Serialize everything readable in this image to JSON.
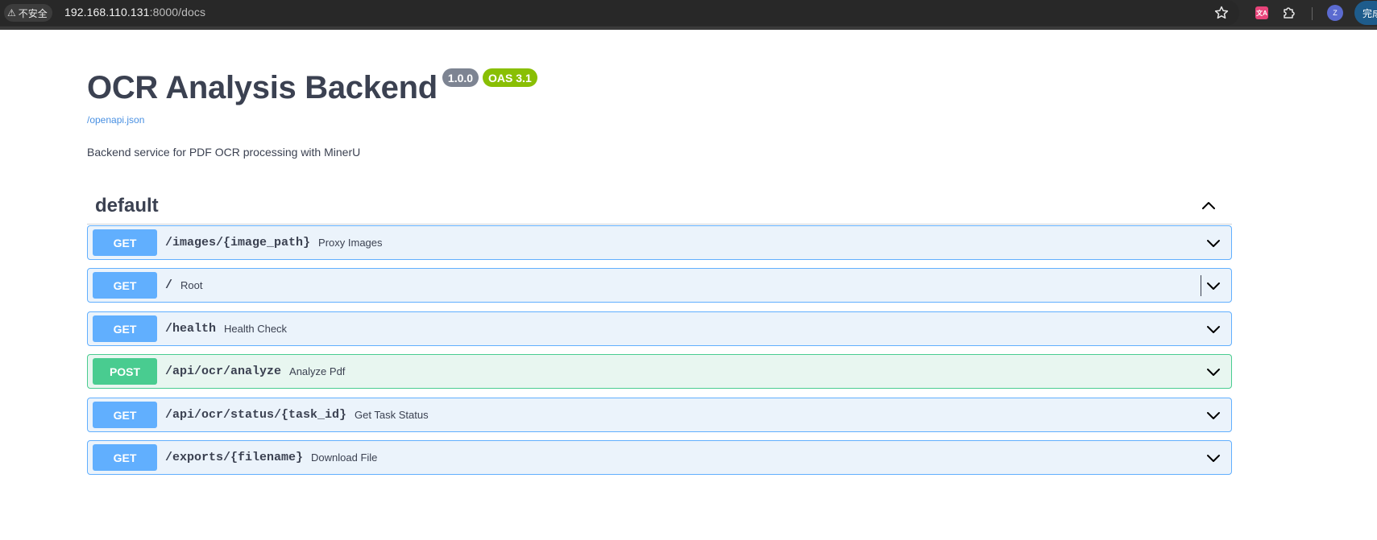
{
  "browser": {
    "security_label": "不安全",
    "url_host": "192.168.110.131",
    "url_path": ":8000/docs",
    "profile_initial": "Z",
    "finish_label": "完成"
  },
  "api": {
    "title": "OCR Analysis Backend",
    "version": "1.0.0",
    "oas_version": "OAS 3.1",
    "spec_link": "/openapi.json",
    "description": "Backend service for PDF OCR processing with MinerU"
  },
  "tag": {
    "name": "default"
  },
  "operations": [
    {
      "method": "GET",
      "path": "/images/{image_path}",
      "summary": "Proxy Images"
    },
    {
      "method": "GET",
      "path": "/",
      "summary": "Root"
    },
    {
      "method": "GET",
      "path": "/health",
      "summary": "Health Check"
    },
    {
      "method": "POST",
      "path": "/api/ocr/analyze",
      "summary": "Analyze Pdf"
    },
    {
      "method": "GET",
      "path": "/api/ocr/status/{task_id}",
      "summary": "Get Task Status"
    },
    {
      "method": "GET",
      "path": "/exports/{filename}",
      "summary": "Download File"
    }
  ],
  "colors": {
    "get": "#61affe",
    "post": "#49cc90",
    "version_badge": "#7d8492",
    "oas_badge": "#89bf04",
    "link": "#4990e2"
  }
}
